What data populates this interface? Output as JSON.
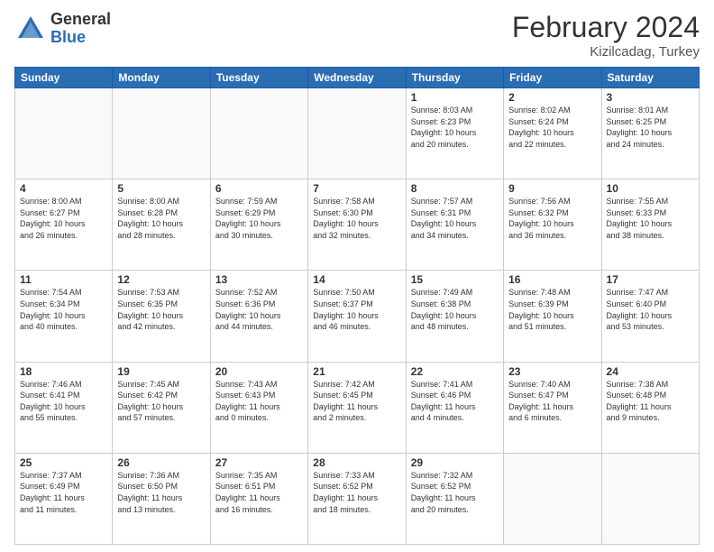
{
  "header": {
    "logo_general": "General",
    "logo_blue": "Blue",
    "month_year": "February 2024",
    "location": "Kizilcadag, Turkey"
  },
  "weekdays": [
    "Sunday",
    "Monday",
    "Tuesday",
    "Wednesday",
    "Thursday",
    "Friday",
    "Saturday"
  ],
  "weeks": [
    [
      {
        "day": "",
        "info": ""
      },
      {
        "day": "",
        "info": ""
      },
      {
        "day": "",
        "info": ""
      },
      {
        "day": "",
        "info": ""
      },
      {
        "day": "1",
        "info": "Sunrise: 8:03 AM\nSunset: 6:23 PM\nDaylight: 10 hours\nand 20 minutes."
      },
      {
        "day": "2",
        "info": "Sunrise: 8:02 AM\nSunset: 6:24 PM\nDaylight: 10 hours\nand 22 minutes."
      },
      {
        "day": "3",
        "info": "Sunrise: 8:01 AM\nSunset: 6:25 PM\nDaylight: 10 hours\nand 24 minutes."
      }
    ],
    [
      {
        "day": "4",
        "info": "Sunrise: 8:00 AM\nSunset: 6:27 PM\nDaylight: 10 hours\nand 26 minutes."
      },
      {
        "day": "5",
        "info": "Sunrise: 8:00 AM\nSunset: 6:28 PM\nDaylight: 10 hours\nand 28 minutes."
      },
      {
        "day": "6",
        "info": "Sunrise: 7:59 AM\nSunset: 6:29 PM\nDaylight: 10 hours\nand 30 minutes."
      },
      {
        "day": "7",
        "info": "Sunrise: 7:58 AM\nSunset: 6:30 PM\nDaylight: 10 hours\nand 32 minutes."
      },
      {
        "day": "8",
        "info": "Sunrise: 7:57 AM\nSunset: 6:31 PM\nDaylight: 10 hours\nand 34 minutes."
      },
      {
        "day": "9",
        "info": "Sunrise: 7:56 AM\nSunset: 6:32 PM\nDaylight: 10 hours\nand 36 minutes."
      },
      {
        "day": "10",
        "info": "Sunrise: 7:55 AM\nSunset: 6:33 PM\nDaylight: 10 hours\nand 38 minutes."
      }
    ],
    [
      {
        "day": "11",
        "info": "Sunrise: 7:54 AM\nSunset: 6:34 PM\nDaylight: 10 hours\nand 40 minutes."
      },
      {
        "day": "12",
        "info": "Sunrise: 7:53 AM\nSunset: 6:35 PM\nDaylight: 10 hours\nand 42 minutes."
      },
      {
        "day": "13",
        "info": "Sunrise: 7:52 AM\nSunset: 6:36 PM\nDaylight: 10 hours\nand 44 minutes."
      },
      {
        "day": "14",
        "info": "Sunrise: 7:50 AM\nSunset: 6:37 PM\nDaylight: 10 hours\nand 46 minutes."
      },
      {
        "day": "15",
        "info": "Sunrise: 7:49 AM\nSunset: 6:38 PM\nDaylight: 10 hours\nand 48 minutes."
      },
      {
        "day": "16",
        "info": "Sunrise: 7:48 AM\nSunset: 6:39 PM\nDaylight: 10 hours\nand 51 minutes."
      },
      {
        "day": "17",
        "info": "Sunrise: 7:47 AM\nSunset: 6:40 PM\nDaylight: 10 hours\nand 53 minutes."
      }
    ],
    [
      {
        "day": "18",
        "info": "Sunrise: 7:46 AM\nSunset: 6:41 PM\nDaylight: 10 hours\nand 55 minutes."
      },
      {
        "day": "19",
        "info": "Sunrise: 7:45 AM\nSunset: 6:42 PM\nDaylight: 10 hours\nand 57 minutes."
      },
      {
        "day": "20",
        "info": "Sunrise: 7:43 AM\nSunset: 6:43 PM\nDaylight: 11 hours\nand 0 minutes."
      },
      {
        "day": "21",
        "info": "Sunrise: 7:42 AM\nSunset: 6:45 PM\nDaylight: 11 hours\nand 2 minutes."
      },
      {
        "day": "22",
        "info": "Sunrise: 7:41 AM\nSunset: 6:46 PM\nDaylight: 11 hours\nand 4 minutes."
      },
      {
        "day": "23",
        "info": "Sunrise: 7:40 AM\nSunset: 6:47 PM\nDaylight: 11 hours\nand 6 minutes."
      },
      {
        "day": "24",
        "info": "Sunrise: 7:38 AM\nSunset: 6:48 PM\nDaylight: 11 hours\nand 9 minutes."
      }
    ],
    [
      {
        "day": "25",
        "info": "Sunrise: 7:37 AM\nSunset: 6:49 PM\nDaylight: 11 hours\nand 11 minutes."
      },
      {
        "day": "26",
        "info": "Sunrise: 7:36 AM\nSunset: 6:50 PM\nDaylight: 11 hours\nand 13 minutes."
      },
      {
        "day": "27",
        "info": "Sunrise: 7:35 AM\nSunset: 6:51 PM\nDaylight: 11 hours\nand 16 minutes."
      },
      {
        "day": "28",
        "info": "Sunrise: 7:33 AM\nSunset: 6:52 PM\nDaylight: 11 hours\nand 18 minutes."
      },
      {
        "day": "29",
        "info": "Sunrise: 7:32 AM\nSunset: 6:52 PM\nDaylight: 11 hours\nand 20 minutes."
      },
      {
        "day": "",
        "info": ""
      },
      {
        "day": "",
        "info": ""
      }
    ]
  ]
}
